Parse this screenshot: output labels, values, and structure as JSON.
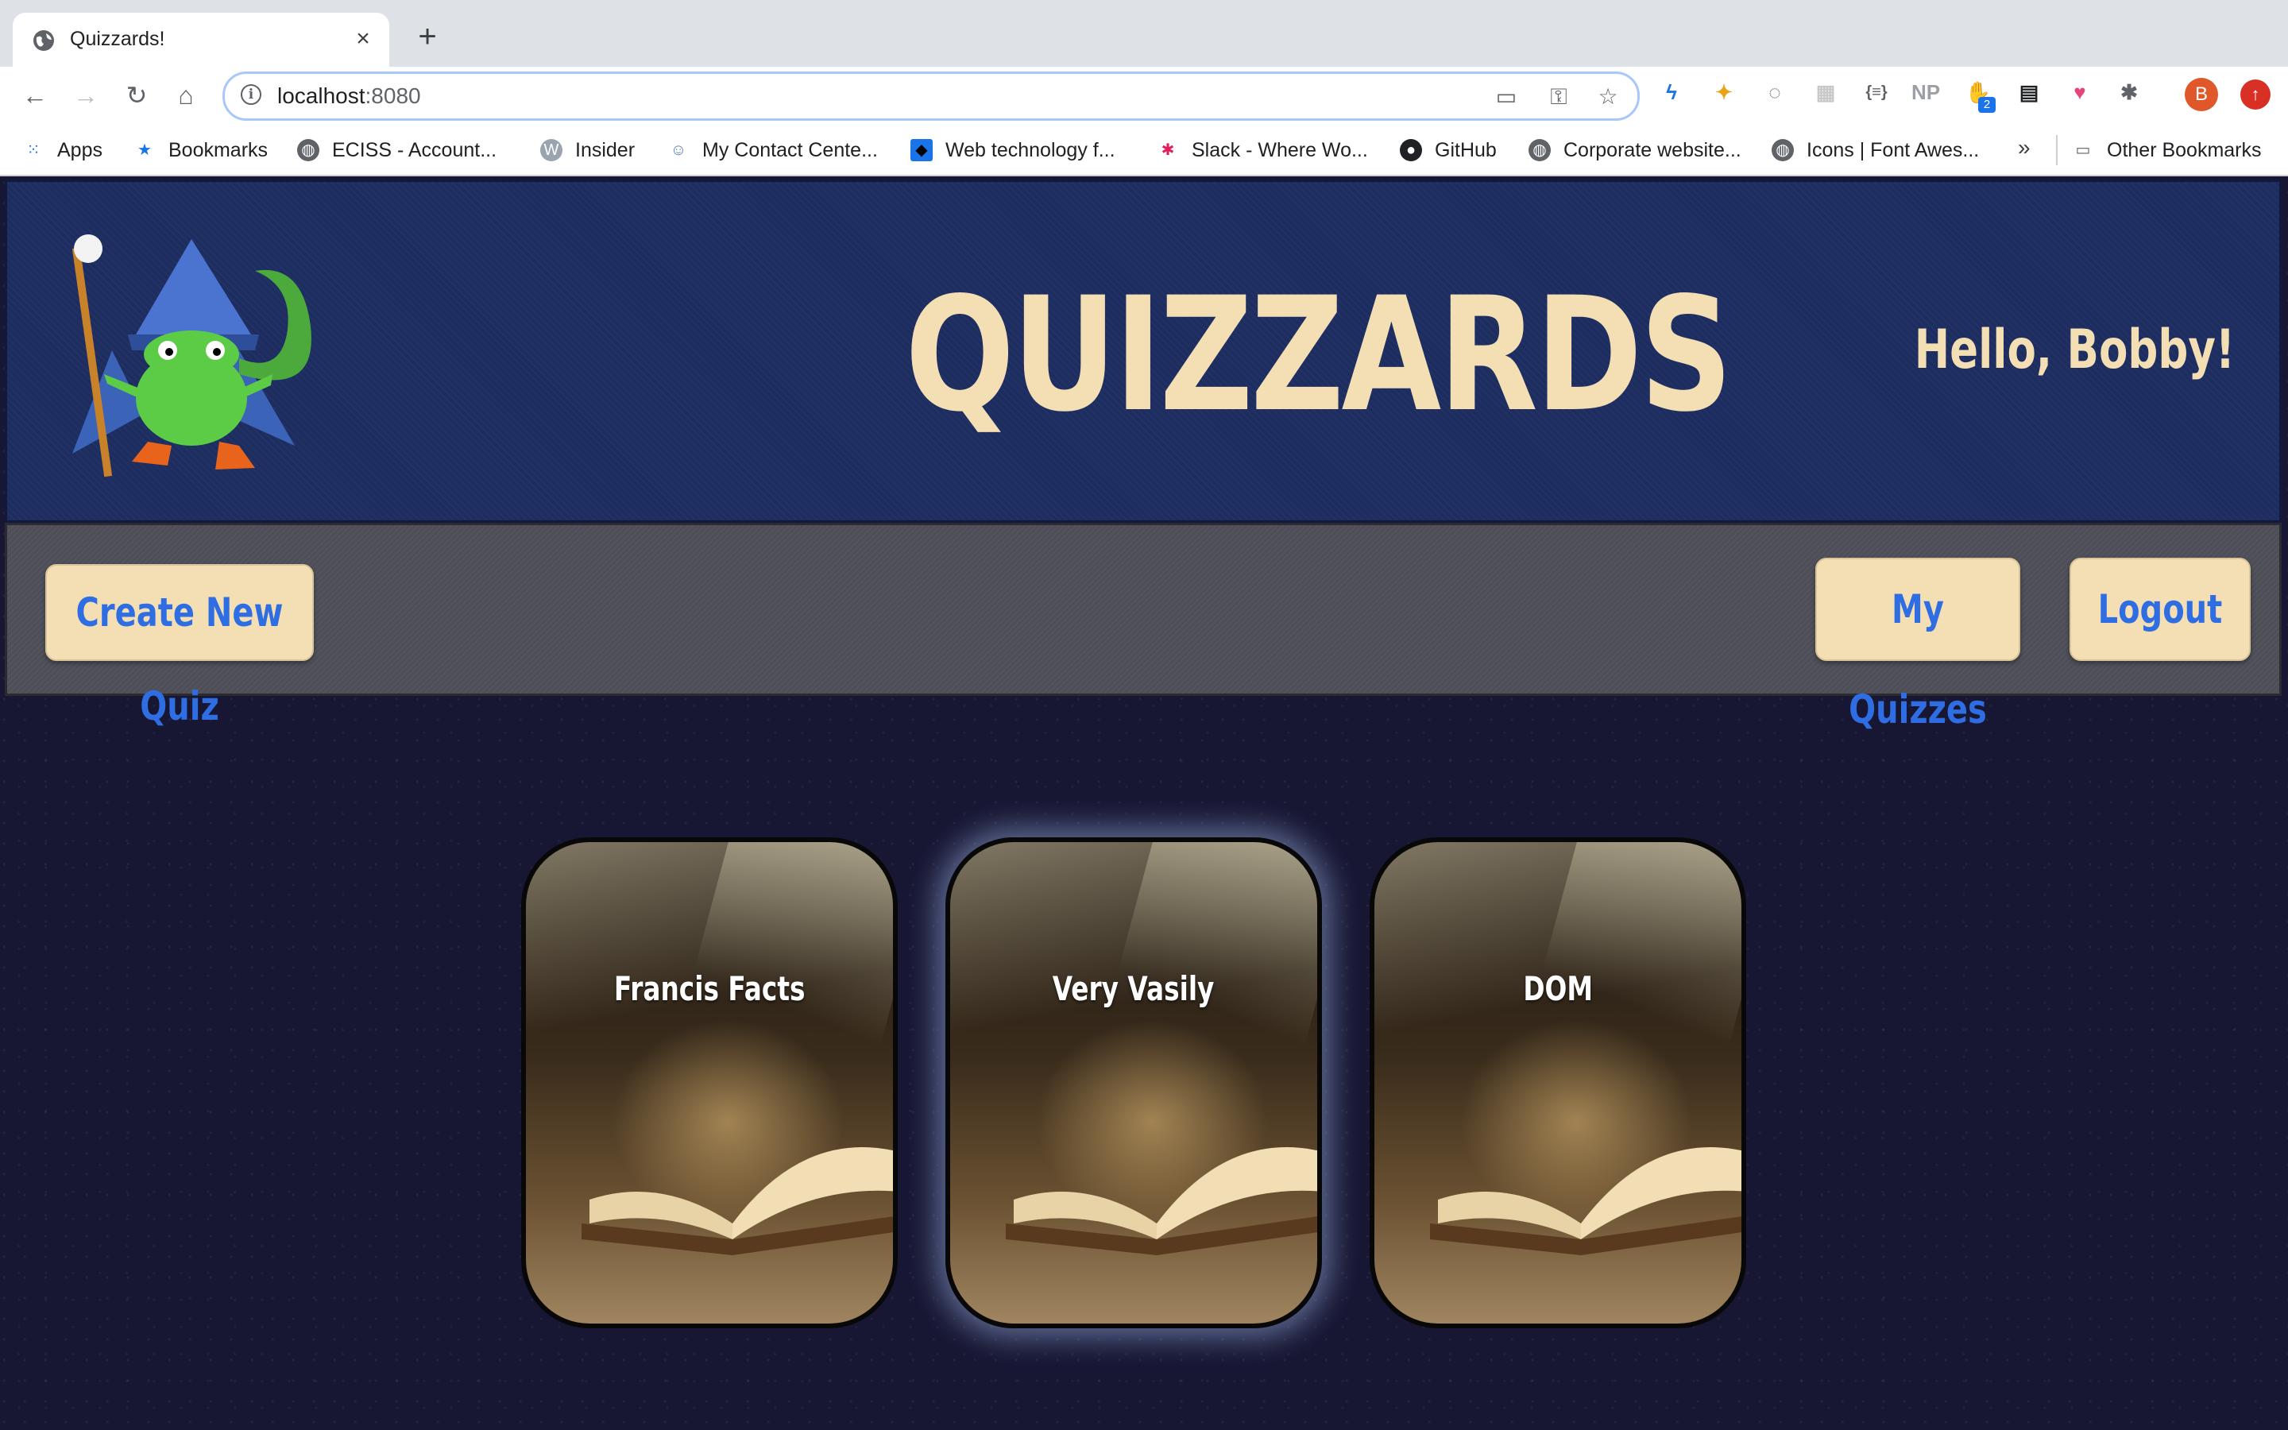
{
  "browser": {
    "tab_title": "Quizzards!",
    "new_tab_symbol": "+",
    "close_symbol": "×",
    "url_host": "localhost",
    "url_port": ":8080",
    "bookmarks": [
      {
        "label": "Apps",
        "icon": "apps-grid-icon"
      },
      {
        "label": "Bookmarks",
        "icon": "star-icon"
      },
      {
        "label": "ECISS - Account...",
        "icon": "globe-icon"
      },
      {
        "label": "Insider",
        "icon": "wordpress-icon"
      },
      {
        "label": "My Contact Cente...",
        "icon": "contact-icon"
      },
      {
        "label": "Web technology f...",
        "icon": "mdn-icon"
      },
      {
        "label": "Slack - Where Wo...",
        "icon": "slack-icon"
      },
      {
        "label": "GitHub",
        "icon": "github-icon"
      },
      {
        "label": "Corporate website...",
        "icon": "globe-icon"
      },
      {
        "label": "Icons | Font Awes...",
        "icon": "globe-icon"
      }
    ],
    "more_bookmarks": "»",
    "other_bookmarks": "Other Bookmarks",
    "profile_initial": "B",
    "extension_badge": "2",
    "extension_np": "NP"
  },
  "site": {
    "title": "QUIZZARDS",
    "greeting": "Hello, Bobby!",
    "colors": {
      "header": "#1d2d60",
      "navbar": "#4e4e58",
      "accent_text": "#f4dfb5",
      "button_text": "#2f6de3"
    }
  },
  "nav": {
    "create": "Create New Quiz",
    "my_quizzes": "My Quizzes",
    "logout": "Logout"
  },
  "quizzes": [
    {
      "title": "Francis Facts"
    },
    {
      "title": "Very Vasily"
    },
    {
      "title": "DOM"
    }
  ]
}
